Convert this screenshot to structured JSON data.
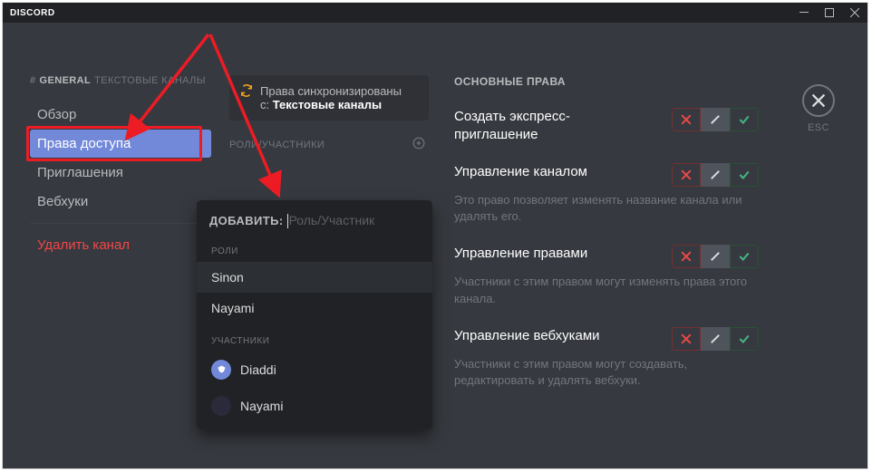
{
  "titlebar": {
    "title": "DISCORD"
  },
  "breadcrumb": {
    "hash": "#",
    "channel": "GENERAL",
    "category": "ТЕКСТОВЫЕ КАНАЛЫ"
  },
  "nav": {
    "overview": "Обзор",
    "permissions": "Права доступа",
    "invitations": "Приглашения",
    "webhooks": "Вебхуки",
    "delete": "Удалить канал"
  },
  "sync": {
    "line1": "Права синхронизированы",
    "line2_prefix": "с: ",
    "line2_bold": "Текстовые каналы"
  },
  "roles_header": "РОЛИ/УЧАСТНИКИ",
  "popover": {
    "add_label": "ДОБАВИТЬ:",
    "placeholder": "Роль/Участник",
    "roles_label": "РОЛИ",
    "members_label": "УЧАСТНИКИ",
    "roles": [
      "Sinon",
      "Nayami"
    ],
    "members": [
      "Diaddi",
      "Nayami"
    ]
  },
  "perms": {
    "header": "ОСНОВНЫЕ ПРАВА",
    "items": [
      {
        "title": "Создать экспресс-приглашение",
        "desc": ""
      },
      {
        "title": "Управление каналом",
        "desc": "Это право позволяет изменять название канала или удалять его."
      },
      {
        "title": "Управление правами",
        "desc": "Участники с этим правом могут изменять права этого канала."
      },
      {
        "title": "Управление вебхуками",
        "desc": "Участники с этим правом могут создавать, редактировать и удалять вебхуки."
      }
    ]
  },
  "closer": {
    "esc": "ESC"
  }
}
